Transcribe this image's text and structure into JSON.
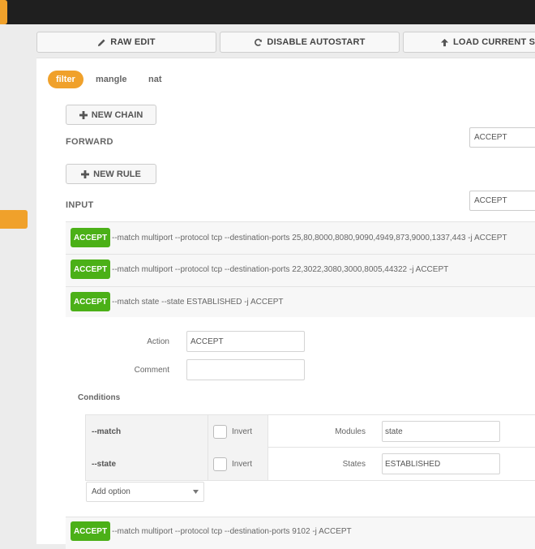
{
  "toolbar": {
    "raw_edit": "RAW EDIT",
    "disable_autostart": "DISABLE AUTOSTART",
    "load_current": "LOAD CURRENT STA"
  },
  "tabs": [
    {
      "label": "filter",
      "active": true
    },
    {
      "label": "mangle",
      "active": false
    },
    {
      "label": "nat",
      "active": false
    }
  ],
  "chains": {
    "new_chain_label": "NEW CHAIN",
    "new_rule_label": "NEW RULE",
    "forward": {
      "name": "FORWARD",
      "policy": "ACCEPT"
    },
    "input": {
      "name": "INPUT",
      "policy": "ACCEPT"
    }
  },
  "rules": [
    {
      "action": "ACCEPT",
      "text": "--match multiport --protocol tcp --destination-ports 25,80,8000,8080,9090,4949,873,9000,1337,443 -j ACCEPT"
    },
    {
      "action": "ACCEPT",
      "text": "--match multiport --protocol tcp --destination-ports 22,3022,3080,3000,8005,44322 -j ACCEPT"
    },
    {
      "action": "ACCEPT",
      "text": "--match state --state ESTABLISHED -j ACCEPT"
    },
    {
      "action": "ACCEPT",
      "text": "--match multiport --protocol tcp --destination-ports 9102 -j ACCEPT"
    }
  ],
  "editor": {
    "action_label": "Action",
    "action_value": "ACCEPT",
    "comment_label": "Comment",
    "comment_value": "",
    "conditions_title": "Conditions",
    "conditions": [
      {
        "name": "--match",
        "invert_label": "Invert",
        "inverted": false,
        "field_label": "Modules",
        "value": "state"
      },
      {
        "name": "--state",
        "invert_label": "Invert",
        "inverted": false,
        "field_label": "States",
        "value": "ESTABLISHED"
      }
    ],
    "add_option": "Add option"
  },
  "icons": {
    "raw_edit": "pencil-icon",
    "autostart": "refresh-icon",
    "load": "arrow-up-icon",
    "new": "plus-icon",
    "dropdown": "caret-down-icon"
  },
  "colors": {
    "accent": "#f0a12b",
    "accept_badge": "#4bb017",
    "topbar": "#1f1f1f"
  }
}
